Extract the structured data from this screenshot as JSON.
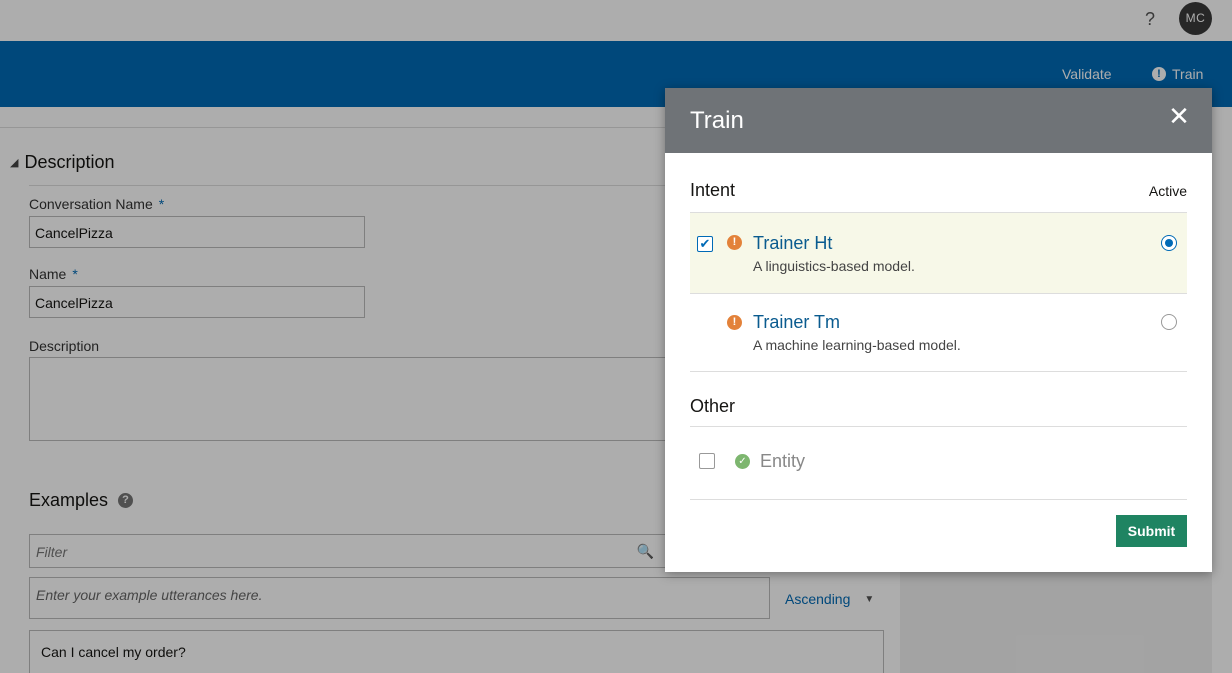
{
  "topbar": {
    "help_icon": "?",
    "avatar_initials": "MC"
  },
  "toolbar": {
    "validate_label": "Validate",
    "train_label": "Train"
  },
  "form": {
    "section_title": "Description",
    "conversation_name_label": "Conversation Name",
    "conversation_name_value": "CancelPizza",
    "name_label": "Name",
    "name_value": "CancelPizza",
    "description_label": "Description",
    "required_mark": "*"
  },
  "examples": {
    "title": "Examples",
    "filter_placeholder": "Filter",
    "utterance_placeholder": "Enter your example utterances here.",
    "sort_label": "Ascending",
    "rows": [
      "Can I cancel my order?"
    ]
  },
  "dialog": {
    "title": "Train",
    "intent_label": "Intent",
    "active_label": "Active",
    "options": [
      {
        "title": "Trainer Ht",
        "desc": "A linguistics-based model.",
        "checked": true,
        "active": true
      },
      {
        "title": "Trainer Tm",
        "desc": "A machine learning-based model.",
        "checked": false,
        "active": false
      }
    ],
    "other_label": "Other",
    "entity_label": "Entity",
    "submit_label": "Submit"
  },
  "colors": {
    "accent": "#006ab6",
    "submit": "#1f8462",
    "warning": "#e3823a",
    "success": "#7db66f"
  }
}
